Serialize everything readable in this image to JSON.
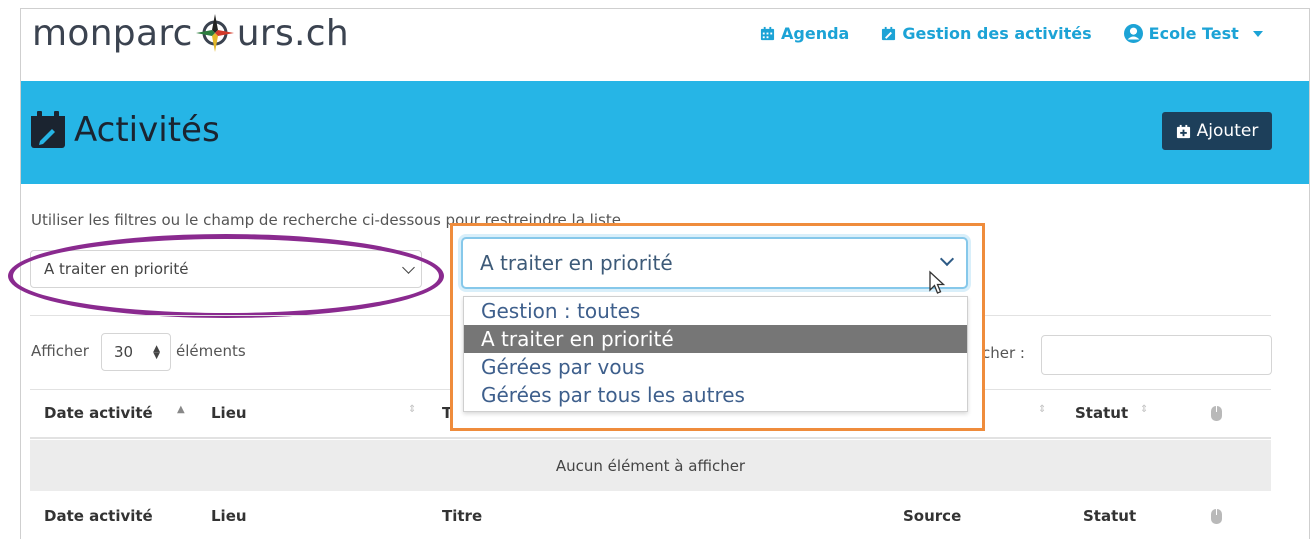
{
  "brand": {
    "prefix": "monparc",
    "suffix": "urs.ch"
  },
  "nav": {
    "agenda": "Agenda",
    "activities": "Gestion des activités",
    "user": "Ecole Test"
  },
  "banner": {
    "title": "Activités",
    "add_label": "Ajouter",
    "color": "#26b5e6"
  },
  "filters": {
    "hint": "Utiliser les filtres ou le champ de recherche ci-dessous pour restreindre la liste",
    "selected": "A traiter en priorité",
    "options": [
      "Gestion : toutes",
      "A traiter en priorité",
      "Gérées par vous",
      "Gérées par tous les autres"
    ]
  },
  "list_controls": {
    "show_label": "Afficher",
    "page_length": "30",
    "items_label": "éléments",
    "search_label": "cher :"
  },
  "table": {
    "headers": [
      "Date activité",
      "Lieu",
      "T",
      "Statut"
    ],
    "empty_message": "Aucun élément à afficher",
    "footers": [
      "Date activité",
      "Lieu",
      "Titre",
      "Source",
      "Statut"
    ]
  },
  "colors": {
    "accent": "#1ca3d6",
    "dark_button": "#1d3f5a",
    "highlight_orange": "#ef8c3c",
    "highlight_purple": "#8a2a8f"
  }
}
